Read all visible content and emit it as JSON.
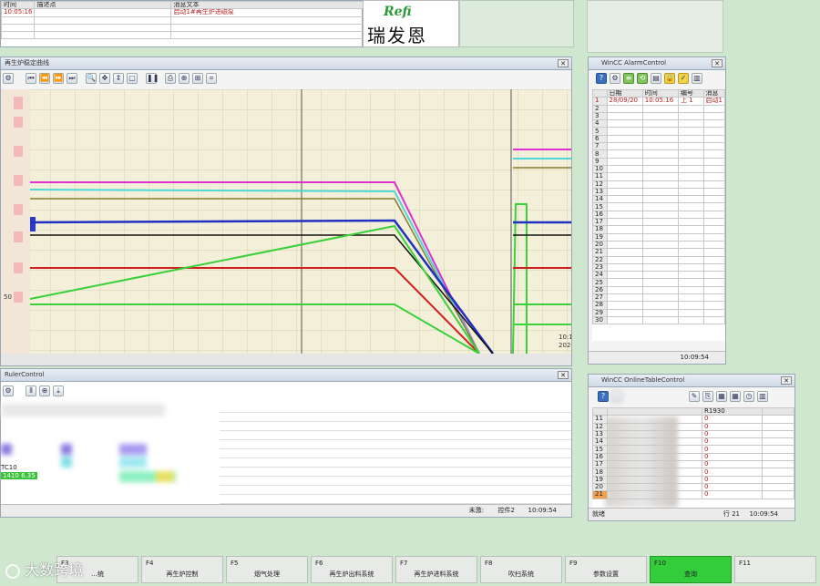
{
  "top_alarm": {
    "headers": [
      "时间",
      "描述点",
      "消息文本"
    ],
    "first_row": [
      "10:05:16",
      "",
      "启动1#再生炉进磁泵"
    ]
  },
  "logo": {
    "brand": "Refi",
    "chinese": "瑞发恩"
  },
  "trend_window": {
    "title": "再生炉稳定曲线",
    "ytick": "50",
    "time_label_1": "10:1",
    "time_label_2": "2020"
  },
  "alarm_window": {
    "title": "WinCC AlarmControl",
    "headers": [
      "",
      "日期",
      "时间",
      "编号",
      "消息"
    ],
    "first_row": [
      "1",
      "28/09/20",
      "10:05:16",
      "上 1",
      "启动1"
    ],
    "row_numbers": [
      "1",
      "2",
      "3",
      "4",
      "5",
      "6",
      "7",
      "8",
      "9",
      "10",
      "11",
      "12",
      "13",
      "14",
      "15",
      "16",
      "17",
      "18",
      "19",
      "20",
      "21",
      "22",
      "23",
      "24",
      "25",
      "26",
      "27",
      "28",
      "29",
      "30"
    ],
    "status_time": "10:09:54"
  },
  "bottom_left_window": {
    "title": "RulerControl",
    "row_label_1": "TC10",
    "row_label_2": "1410",
    "row_label_2b": "6.35",
    "status_left": "未激:",
    "status_mid": "控件2",
    "status_time": "10:09:54"
  },
  "table_window": {
    "title": "WinCC OnlineTableControl",
    "col_header": "R1930",
    "rows": [
      {
        "n": "11",
        "v": "0"
      },
      {
        "n": "12",
        "v": "0"
      },
      {
        "n": "13",
        "v": "0"
      },
      {
        "n": "14",
        "v": "0"
      },
      {
        "n": "15",
        "v": "0"
      },
      {
        "n": "16",
        "v": "0"
      },
      {
        "n": "17",
        "v": "0"
      },
      {
        "n": "18",
        "v": "0"
      },
      {
        "n": "19",
        "v": "0"
      },
      {
        "n": "20",
        "v": "0"
      },
      {
        "n": "21",
        "v": "0"
      }
    ],
    "status_ready": "就绪",
    "status_row": "行 21",
    "status_time": "10:09:54"
  },
  "fkeys": [
    {
      "key": "F3",
      "label": "…统"
    },
    {
      "key": "F4",
      "label": "再生炉控制"
    },
    {
      "key": "F5",
      "label": "烟气处理"
    },
    {
      "key": "F6",
      "label": "再生炉出料系统"
    },
    {
      "key": "F7",
      "label": "再生炉进料系统"
    },
    {
      "key": "F8",
      "label": "吹扫系统"
    },
    {
      "key": "F9",
      "label": "参数设置"
    },
    {
      "key": "F10",
      "label": "查询"
    },
    {
      "key": "F11",
      "label": ""
    }
  ],
  "watermark": "大数跨境",
  "colors": {
    "active_fkey": "#33cc3a",
    "background": "#cfe6cf"
  }
}
